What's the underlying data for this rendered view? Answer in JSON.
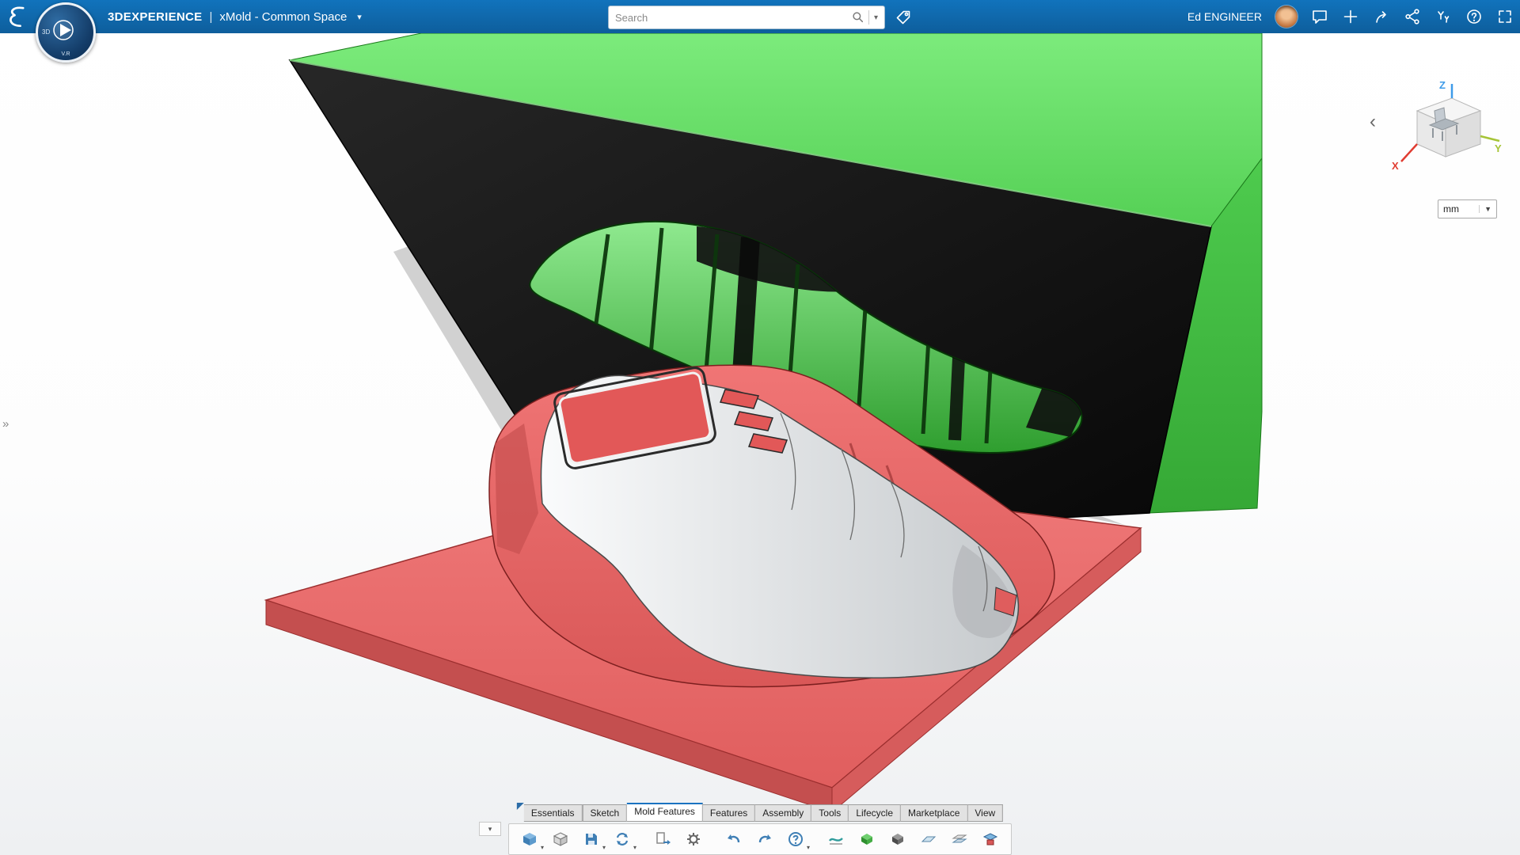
{
  "colors": {
    "topbar_bg": "#1173BC",
    "topbar_bg_dark": "#0E5E9C",
    "mold_green": "#6FE36F",
    "mold_green_deep": "#2E9E2E",
    "mold_black": "#161616",
    "mold_red": "#EC6F6F",
    "mold_red_dark": "#C84E4E",
    "part_white": "#F4F5F6",
    "part_gray": "#C9CCCE",
    "screen_red": "#E25858",
    "axis_x": "#E03C31",
    "axis_y": "#A6C437",
    "axis_z": "#3E9BE9",
    "tab_active_accent": "#1A73C1"
  },
  "topbar": {
    "brand": "3DEXPERIENCE",
    "separator": "|",
    "app_title": "xMold - Common Space",
    "user_name": "Ed ENGINEER"
  },
  "search": {
    "placeholder": "Search"
  },
  "compass": {
    "left": "3D",
    "bottom": "V.R"
  },
  "viewport": {
    "units": "mm",
    "axis_x": "X",
    "axis_y": "Y",
    "axis_z": "Z"
  },
  "glyphs": {
    "menu_caret": "▾",
    "units_caret": "▼",
    "panel_back": "‹",
    "panel_expand": "»"
  },
  "action_bar": {
    "active_tab": "Mold Features",
    "tabs": [
      {
        "label": "Essentials"
      },
      {
        "label": "Sketch"
      },
      {
        "label": "Mold Features"
      },
      {
        "label": "Features"
      },
      {
        "label": "Assembly"
      },
      {
        "label": "Tools"
      },
      {
        "label": "Lifecycle"
      },
      {
        "label": "Marketplace"
      },
      {
        "label": "View"
      }
    ],
    "tools": [
      "part",
      "box",
      "save",
      "sync",
      "export",
      "settings",
      "undo",
      "redo",
      "help",
      "parting-surface",
      "cavity-block",
      "core-block",
      "surface",
      "plates",
      "mold-base"
    ]
  }
}
